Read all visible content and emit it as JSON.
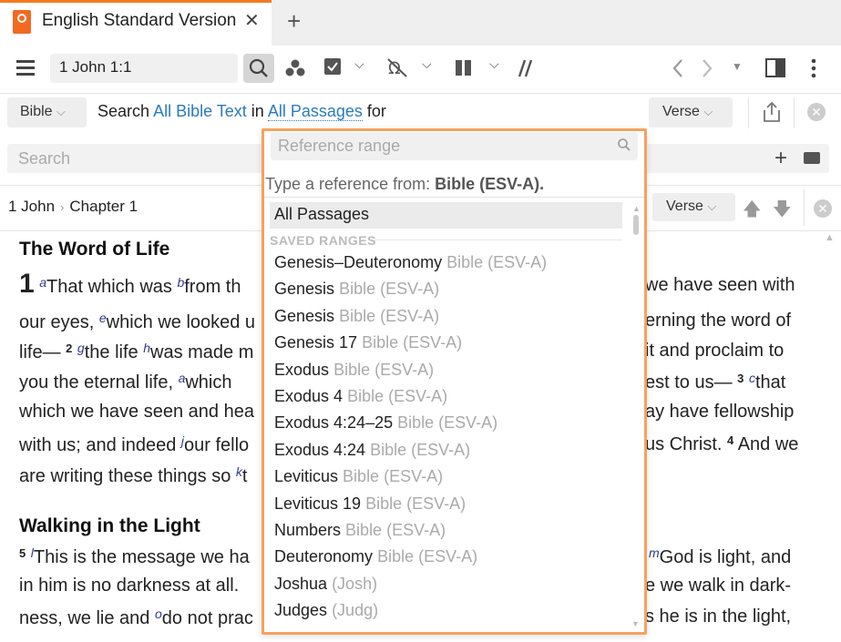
{
  "tab": {
    "title": "English Standard Version",
    "close": "✕",
    "add": "+"
  },
  "toolbar": {
    "reference": "1 John 1:1",
    "icons": [
      "menu-icon",
      "search-icon",
      "people-icon",
      "checklist-icon",
      "omega-icon",
      "columns-icon",
      "parallel-icon",
      "back-icon",
      "forward-icon",
      "layout-icon",
      "more-icon"
    ]
  },
  "search_bar": {
    "bible_button": "Bible",
    "phrase_search": "Search",
    "phrase_scope": "All Bible Text",
    "phrase_in": "in",
    "phrase_range": "All Passages",
    "phrase_for": "for",
    "verse_button": "Verse",
    "search_placeholder": "Search"
  },
  "breadcrumb": {
    "book": "1 John",
    "chapter": "Chapter 1",
    "verse_button": "Verse"
  },
  "text": {
    "heading1": "The Word of Life",
    "heading2": "Walking in the Light"
  },
  "popup": {
    "placeholder": "Reference range",
    "hint_prefix": "Type a reference from:",
    "hint_source": "Bible (ESV-A).",
    "all_passages": "All Passages",
    "saved_header": "SAVED RANGES",
    "items": [
      {
        "name": "Genesis–Deuteronomy",
        "sub": "Bible (ESV-A)"
      },
      {
        "name": "Genesis",
        "sub": "Bible (ESV-A)"
      },
      {
        "name": "Genesis",
        "sub": "Bible (ESV-A)"
      },
      {
        "name": "Genesis 17",
        "sub": "Bible (ESV-A)"
      },
      {
        "name": "Exodus",
        "sub": "Bible (ESV-A)"
      },
      {
        "name": "Exodus 4",
        "sub": "Bible (ESV-A)"
      },
      {
        "name": "Exodus 4:24–25",
        "sub": "Bible (ESV-A)"
      },
      {
        "name": "Exodus 4:24",
        "sub": "Bible (ESV-A)"
      },
      {
        "name": "Leviticus",
        "sub": "Bible (ESV-A)"
      },
      {
        "name": "Leviticus 19",
        "sub": "Bible (ESV-A)"
      },
      {
        "name": "Numbers",
        "sub": "Bible (ESV-A)"
      },
      {
        "name": "Deuteronomy",
        "sub": "Bible (ESV-A)"
      },
      {
        "name": "Joshua",
        "sub": "(Josh)"
      },
      {
        "name": "Judges",
        "sub": "(Judg)"
      }
    ]
  }
}
